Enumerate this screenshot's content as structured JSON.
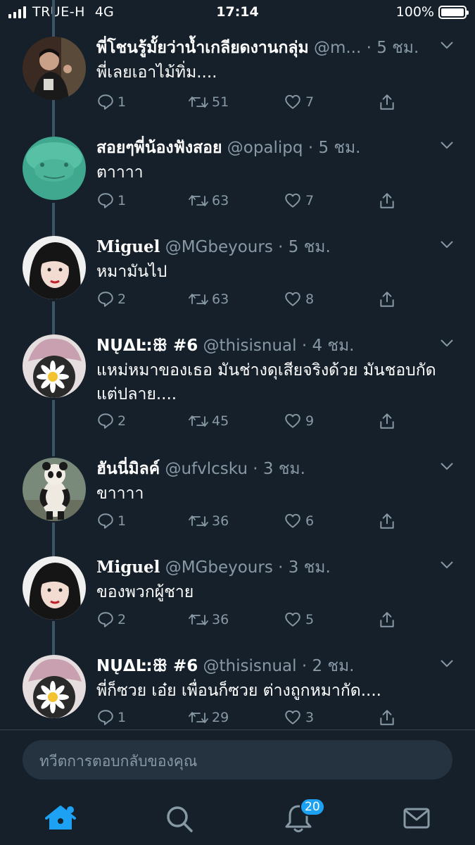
{
  "status_bar": {
    "carrier": "TRUE-H",
    "network": "4G",
    "time": "17:14",
    "battery": "100%",
    "battery_level": 1.0
  },
  "tweets": [
    {
      "name": "พี่โชนรู้มั้ยว่าน้ำเกลียดงานกลุ่ม",
      "handle": "@m...",
      "time": "5 ชม.",
      "text": "พี่เลยเอาไม้ทิ่ม....",
      "replies": "1",
      "retweets": "51",
      "likes": "7"
    },
    {
      "name": "สอยๆพี่น้องฟังสอย",
      "handle": "@opalipq",
      "time": "5 ชม.",
      "text": "ตาาาา",
      "replies": "1",
      "retweets": "63",
      "likes": "7"
    },
    {
      "name": "Miguel",
      "handle": "@MGbeyours",
      "time": "5 ชม.",
      "text": "หมามันไป",
      "replies": "2",
      "retweets": "63",
      "likes": "8"
    },
    {
      "name": "NŲΔĿ:ꕥ #6",
      "handle": "@thisisnual",
      "time": "4 ชม.",
      "text": "แหม่หมาของเธอ มันช่างดุเสียจริงด้วย มันชอบกัดแต่ปลาย....",
      "replies": "2",
      "retweets": "45",
      "likes": "9"
    },
    {
      "name": "ฮันนี่มิลค์",
      "handle": "@ufvlcsku",
      "time": "3 ชม.",
      "text": "ขาาาา",
      "replies": "1",
      "retweets": "36",
      "likes": "6"
    },
    {
      "name": "Miguel",
      "handle": "@MGbeyours",
      "time": "3 ชม.",
      "text": "ของพวกผู้ชาย",
      "replies": "2",
      "retweets": "36",
      "likes": "5"
    },
    {
      "name": "NŲΔĿ:ꕥ #6",
      "handle": "@thisisnual",
      "time": "2 ชม.",
      "text": "พี่ก็ซวย เอ๋ย เพื่อนก็ซวย ต่างถูกหมากัด....",
      "replies": "1",
      "retweets": "29",
      "likes": "3"
    }
  ],
  "composer": {
    "placeholder": "ทวีตการตอบกลับของคุณ"
  },
  "tabbar": {
    "notifications_badge": "20"
  },
  "colors": {
    "background": "#15202b",
    "accent": "#1da1f2",
    "muted": "#8899a6"
  }
}
